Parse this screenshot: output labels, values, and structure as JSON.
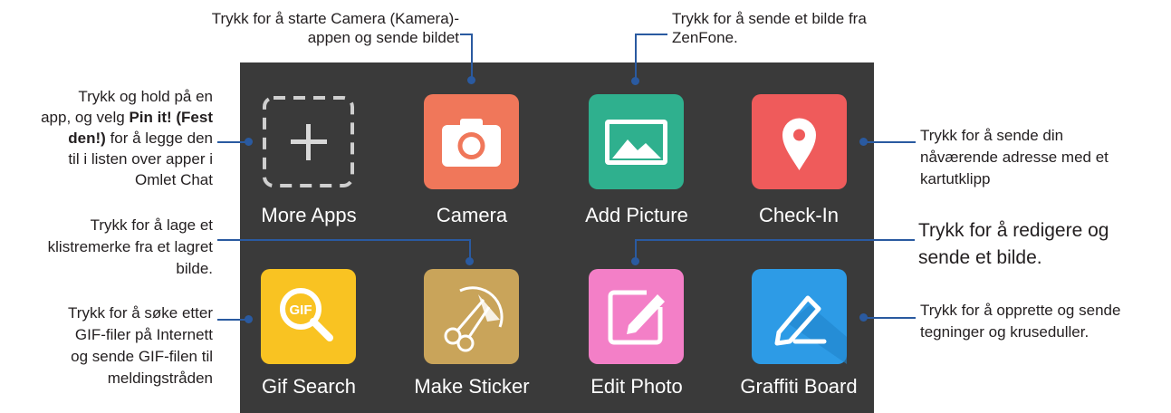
{
  "apps": [
    {
      "id": "more-apps",
      "label": "More Apps",
      "icon": "plus-icon",
      "color": "#3a3a3a"
    },
    {
      "id": "camera",
      "label": "Camera",
      "icon": "camera-icon",
      "color": "#f0775a"
    },
    {
      "id": "add-picture",
      "label": "Add Picture",
      "icon": "picture-icon",
      "color": "#2fb08e"
    },
    {
      "id": "check-in",
      "label": "Check-In",
      "icon": "map-pin-icon",
      "color": "#ef5b5b"
    },
    {
      "id": "gif-search",
      "label": "Gif Search",
      "icon": "gif-search-icon",
      "color": "#f9c322"
    },
    {
      "id": "make-sticker",
      "label": "Make Sticker",
      "icon": "scissors-icon",
      "color": "#c9a45a"
    },
    {
      "id": "edit-photo",
      "label": "Edit Photo",
      "icon": "pencil-icon",
      "color": "#f37fc7"
    },
    {
      "id": "graffiti-board",
      "label": "Graffiti Board",
      "icon": "graffiti-pen-icon",
      "color": "#2d9be6"
    }
  ],
  "callouts": {
    "camera_1": "Trykk for å starte Camera (Kamera)-",
    "camera_2": "appen og sende bildet",
    "add_picture_1": "Trykk for å sende et bilde fra",
    "add_picture_2": "ZenFone.",
    "more_apps_1": "Trykk og hold på en",
    "more_apps_2a": "app, og velg ",
    "more_apps_2b": "Pin it! (Fest",
    "more_apps_3a": "den!)",
    "more_apps_3b": " for å legge den",
    "more_apps_4": "til i listen over apper i",
    "more_apps_5": "Omlet Chat",
    "check_in_1": "Trykk for å sende din",
    "check_in_2": "nåværende adresse med et",
    "check_in_3": "kartutklipp",
    "sticker_1": "Trykk for å lage et",
    "sticker_2": "klistremerke fra et lagret",
    "sticker_3": "bilde.",
    "edit_photo_1": "Trykk for å redigere og",
    "edit_photo_2": "sende et bilde.",
    "gif_1": "Trykk for å søke etter",
    "gif_2": "GIF-filer på Internett",
    "gif_3": "og sende GIF-filen til",
    "gif_4": "meldingstråden",
    "graffiti_1": "Trykk for å opprette og sende",
    "graffiti_2": "tegninger og kruseduller."
  }
}
